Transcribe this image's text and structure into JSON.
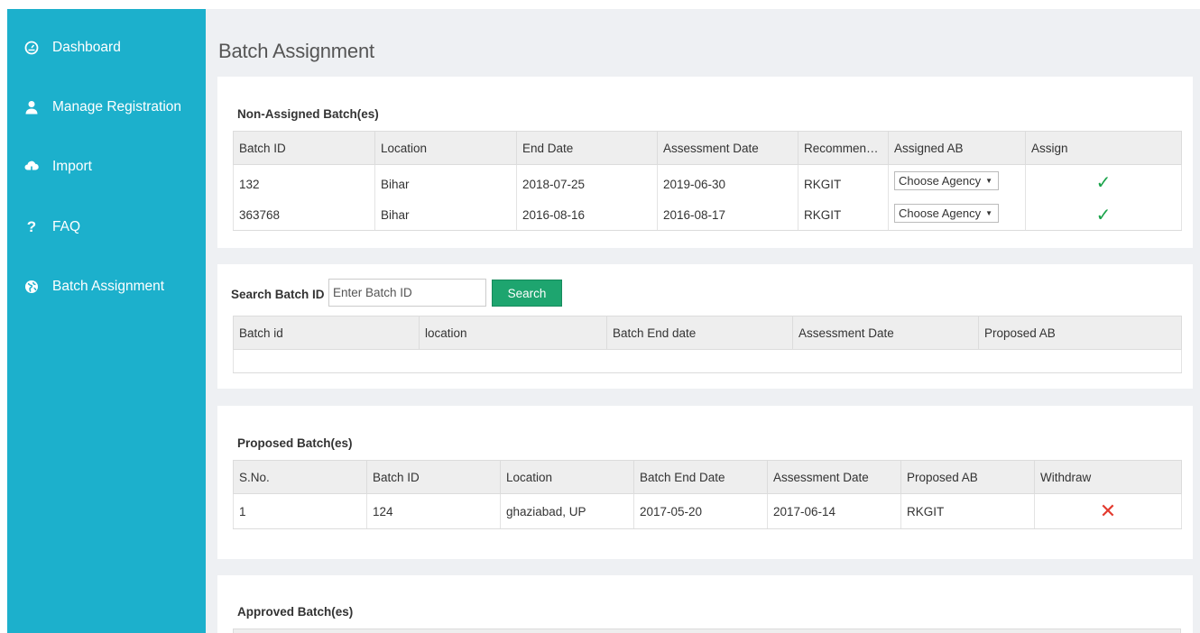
{
  "sidebar": {
    "items": [
      {
        "label": "Dashboard",
        "icon": "dashboard-icon"
      },
      {
        "label": "Manage Registration",
        "icon": "user-icon"
      },
      {
        "label": "Import",
        "icon": "import-icon"
      },
      {
        "label": "FAQ",
        "icon": "question-icon"
      },
      {
        "label": "Batch Assignment",
        "icon": "globe-icon"
      }
    ]
  },
  "page": {
    "title": "Batch Assignment"
  },
  "non_assigned": {
    "heading": "Non-Assigned Batch(es)",
    "columns": [
      "Batch ID",
      "Location",
      "End Date",
      "Assessment Date",
      "Recommended",
      "Assigned AB",
      "Assign"
    ],
    "rows": [
      {
        "batch_id": "132",
        "location": "Bihar",
        "end_date": "2018-07-25",
        "assessment_date": "2019-06-30",
        "recommended": "RKGIT",
        "assigned_ab": "Choose Agency"
      },
      {
        "batch_id": "363768",
        "location": "Bihar",
        "end_date": "2016-08-16",
        "assessment_date": "2016-08-17",
        "recommended": "RKGIT",
        "assigned_ab": "Choose Agency"
      }
    ]
  },
  "search": {
    "label": "Search Batch ID",
    "placeholder": "Enter Batch ID",
    "button_label": "Search",
    "columns": [
      "Batch id",
      "location",
      "Batch End date",
      "Assessment Date",
      "Proposed AB"
    ]
  },
  "proposed": {
    "heading": "Proposed Batch(es)",
    "columns": [
      "S.No.",
      "Batch ID",
      "Location",
      "Batch End Date",
      "Assessment Date",
      "Proposed AB",
      "Withdraw"
    ],
    "rows": [
      {
        "sno": "1",
        "batch_id": "124",
        "location": "ghaziabad, UP",
        "end_date": "2017-05-20",
        "assessment_date": "2017-06-14",
        "proposed_ab": "RKGIT"
      }
    ]
  },
  "approved": {
    "heading": "Approved Batch(es)"
  },
  "colors": {
    "sidebar": "#1cb0cc",
    "content_bg": "#eef0f3",
    "search_button": "#1ea56f",
    "assign_check": "#1aa34a",
    "withdraw_cross": "#e33b2f"
  }
}
